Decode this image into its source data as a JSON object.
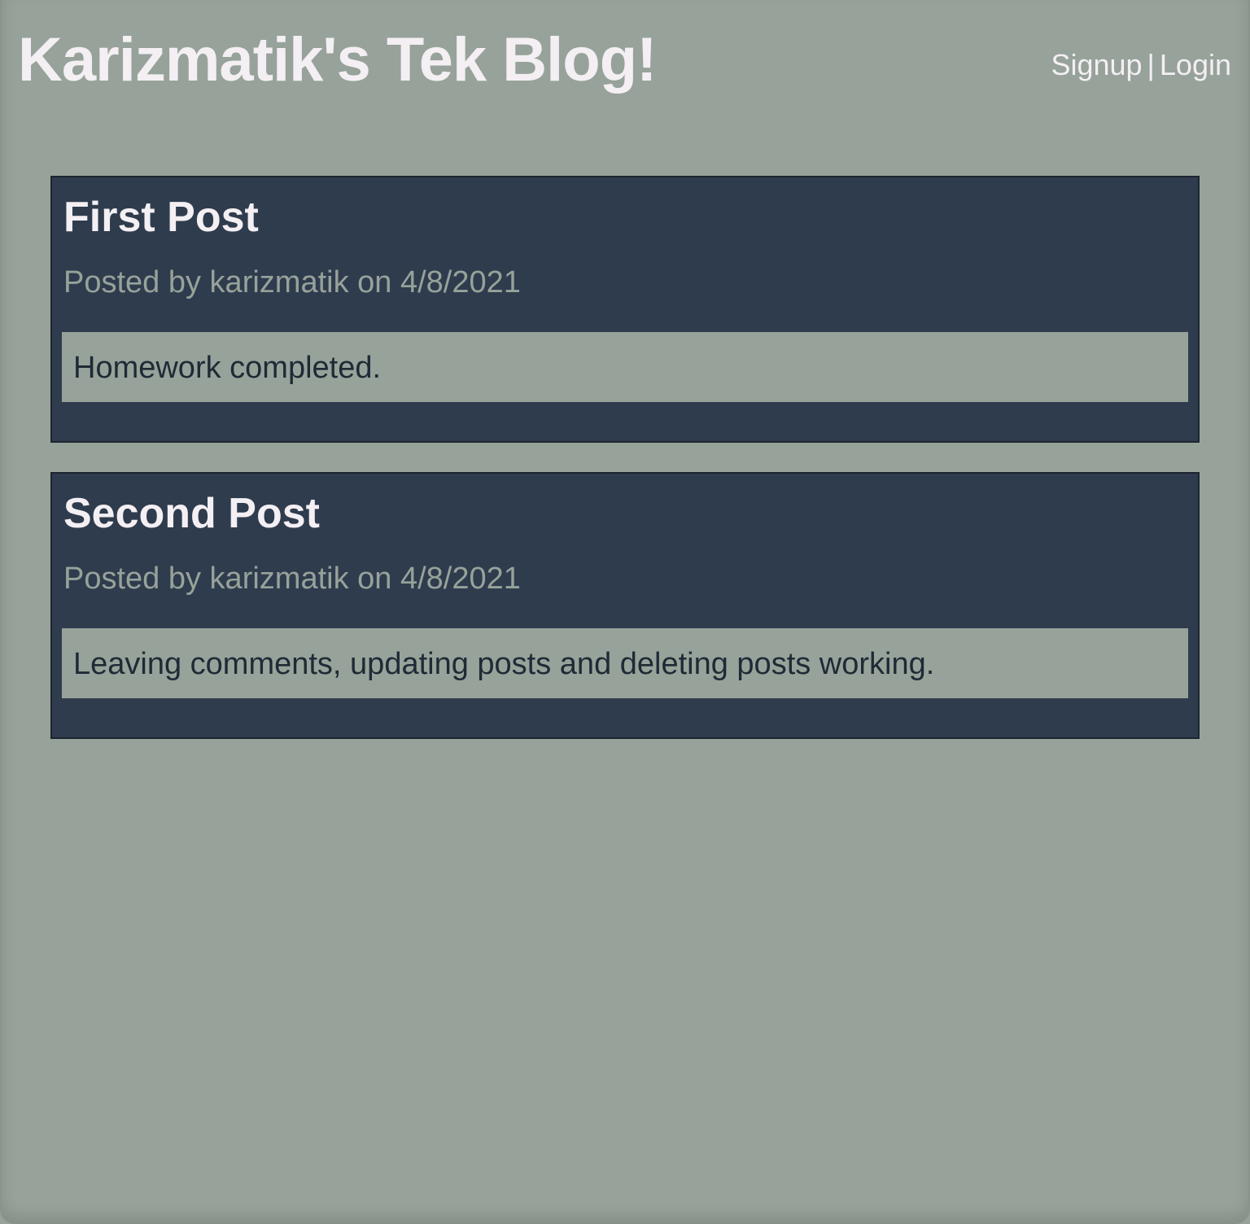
{
  "header": {
    "title": "Karizmatik's Tek Blog!",
    "nav": {
      "signup_label": "Signup",
      "separator": "|",
      "login_label": "Login"
    }
  },
  "posts": [
    {
      "title": "First Post",
      "meta": "Posted by karizmatik on 4/8/2021",
      "body": "Homework completed."
    },
    {
      "title": "Second Post",
      "meta": "Posted by karizmatik on 4/8/2021",
      "body": "Leaving comments, updating posts and deleting posts working."
    }
  ],
  "colors": {
    "page_background": "#97a29a",
    "post_background": "#2f3c4e",
    "heading_text": "#f3eff3",
    "body_text": "#1f2a36"
  }
}
